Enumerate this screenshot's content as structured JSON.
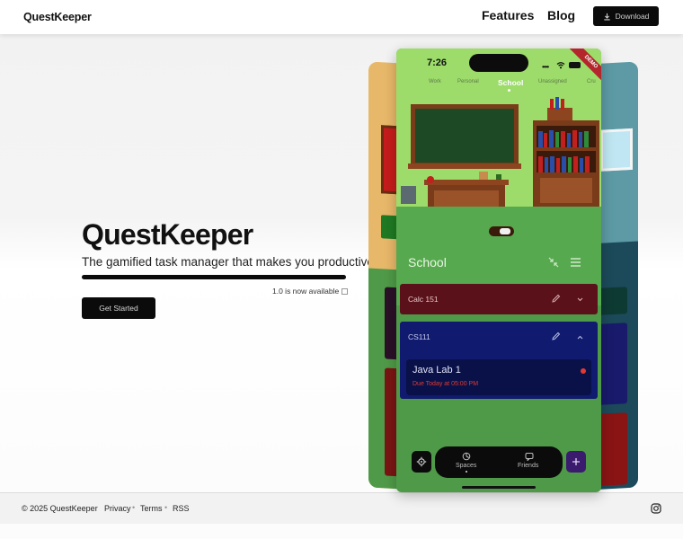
{
  "header": {
    "brand": "QuestKeeper",
    "nav": [
      "Features",
      "Blog"
    ],
    "download_label": "Download"
  },
  "hero": {
    "title": "QuestKeeper",
    "subtitle": "The gamified task manager that makes you productive.",
    "version_note": "1.0 is now available",
    "cta_label": "Get Started"
  },
  "phone": {
    "time": "7:26",
    "ribbon": "DEMO",
    "tabs": [
      "Work",
      "Personal",
      "School",
      "Unassigned",
      "Cru"
    ],
    "active_tab": "School",
    "space_title": "School",
    "groups": [
      {
        "name": "Calc 151",
        "color": "#5a1119"
      },
      {
        "name": "CS111",
        "color": "#101a6e"
      }
    ],
    "task": {
      "title": "Java Lab 1",
      "due": "Due Today at 05:00 PM",
      "due_color": "#e23a32"
    },
    "bottom_nav": [
      "Spaces",
      "Friends"
    ]
  },
  "footer": {
    "copyright": "© 2025 QuestKeeper",
    "links": [
      "Privacy",
      "Terms",
      "RSS"
    ]
  },
  "colors": {
    "accent": "#0b0b0b",
    "phone_green": "#4f9a48",
    "scene_green": "#9ddc6a",
    "calc_card": "#5a1119",
    "cs_card": "#101a6e"
  },
  "icons": [
    "download-icon",
    "square-icon",
    "pencil-icon",
    "chevron-down-icon",
    "chevron-up-icon",
    "collapse-icon",
    "menu-icon",
    "gear-icon",
    "spaces-icon",
    "friends-icon",
    "plus-icon",
    "instagram-icon"
  ]
}
